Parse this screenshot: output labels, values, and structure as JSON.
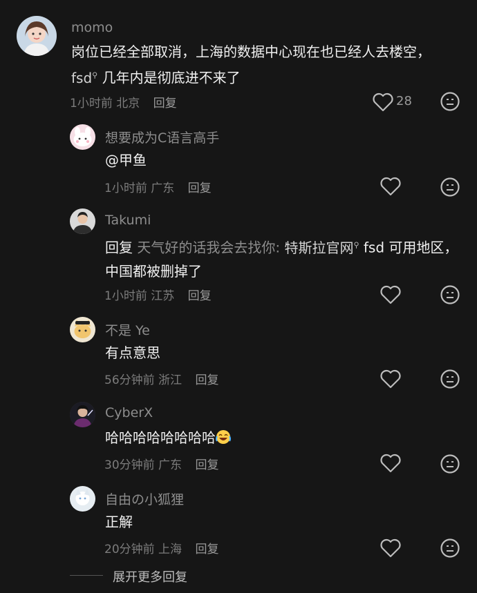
{
  "comments": [
    {
      "username": "momo",
      "content": "岗位已经全部取消，上海的数据中心现在也已经人去楼空，",
      "content_link": "fsd",
      "content_after": "几年内是彻底进不来了",
      "time": "1小时前",
      "location": "北京",
      "reply_label": "回复",
      "likes": "28",
      "avatar": "girl-avatar"
    },
    {
      "username": "想要成为C语言高手",
      "content": "@甲鱼",
      "time": "1小时前",
      "location": "广东",
      "reply_label": "回复",
      "avatar": "pink-bunny-avatar"
    },
    {
      "username": "Takumi",
      "reply_prefix": "回复",
      "reply_to": "天气好的话我会去找你:",
      "content_link": "特斯拉官网",
      "content_after": "fsd 可用地区，中国都被删掉了",
      "time": "1小时前",
      "location": "江苏",
      "reply_label": "回复",
      "avatar": "man-avatar"
    },
    {
      "username": "不是 Ye",
      "content": "有点意思",
      "time": "56分钟前",
      "location": "浙江",
      "reply_label": "回复",
      "avatar": "cat-avatar"
    },
    {
      "username": "CyberX",
      "content": "哈哈哈哈哈哈哈哈",
      "time": "30分钟前",
      "location": "广东",
      "reply_label": "回复",
      "avatar": "dark-character-avatar"
    },
    {
      "username": "自由の小狐狸",
      "content": "正解",
      "time": "20分钟前",
      "location": "上海",
      "reply_label": "回复",
      "avatar": "fox-avatar"
    }
  ],
  "more_replies_label": "展开更多回复",
  "icons": {
    "like": "heart-outline-icon",
    "dislike": "meh-face-icon",
    "search": "search-icon",
    "emoji": "laughing-crying-emoji"
  }
}
